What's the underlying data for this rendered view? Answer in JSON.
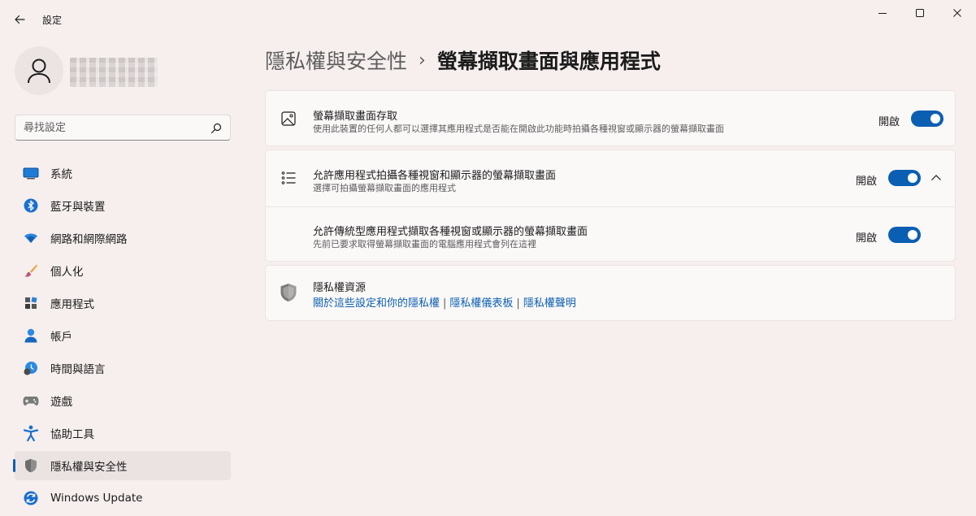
{
  "window": {
    "title": "設定",
    "back_icon": "back-arrow-icon"
  },
  "search": {
    "placeholder": "尋找設定"
  },
  "sidebar": {
    "items": [
      {
        "label": "系統",
        "icon": "system-display-icon"
      },
      {
        "label": "藍牙與裝置",
        "icon": "bluetooth-icon"
      },
      {
        "label": "網路和網際網路",
        "icon": "network-icon"
      },
      {
        "label": "個人化",
        "icon": "paintbrush-icon"
      },
      {
        "label": "應用程式",
        "icon": "apps-icon"
      },
      {
        "label": "帳戶",
        "icon": "account-icon"
      },
      {
        "label": "時間與語言",
        "icon": "time-language-icon"
      },
      {
        "label": "遊戲",
        "icon": "gamepad-icon"
      },
      {
        "label": "協助工具",
        "icon": "accessibility-icon"
      },
      {
        "label": "隱私權與安全性",
        "icon": "shield-icon",
        "active": true
      },
      {
        "label": "Windows Update",
        "icon": "windows-update-icon"
      }
    ]
  },
  "breadcrumb": {
    "parent": "隱私權與安全性",
    "separator": "›",
    "current": "螢幕擷取畫面與應用程式"
  },
  "cards": {
    "screenshot_access": {
      "title": "螢幕擷取畫面存取",
      "desc": "使用此裝置的任何人都可以選擇其應用程式是否能在開啟此功能時拍攝各種視窗或顯示器的螢幕擷取畫面",
      "state": "開啟",
      "on": true
    },
    "allow_apps": {
      "title": "允許應用程式拍攝各種視窗和顯示器的螢幕擷取畫面",
      "desc": "選擇可拍攝螢幕擷取畫面的應用程式",
      "state": "開啟",
      "on": true
    },
    "allow_desktop_apps": {
      "title": "允許傳統型應用程式擷取各種視窗或顯示器的螢幕擷取畫面",
      "desc": "先前已要求取得螢幕擷取畫面的電腦應用程式會列在這裡",
      "state": "開啟",
      "on": true
    },
    "privacy_resources": {
      "title": "隱私權資源",
      "links": [
        "關於這些設定和你的隱私權",
        "隱私權儀表板",
        "隱私權聲明"
      ]
    }
  },
  "colors": {
    "accent": "#0a5fb3",
    "background": "#f6efee",
    "card": "#fbf8f8"
  }
}
